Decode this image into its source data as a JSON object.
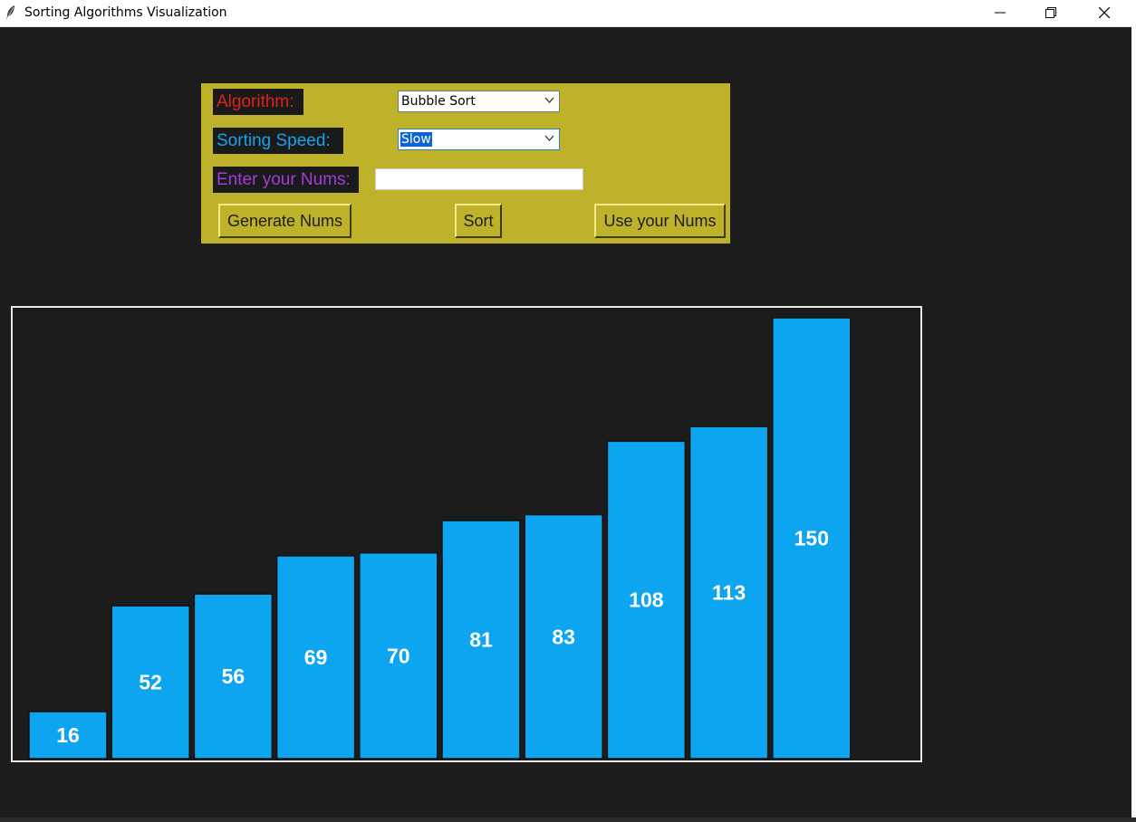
{
  "window": {
    "title": "Sorting Algorithms Visualization",
    "icon": "feather-icon",
    "controls": [
      "minimize-icon",
      "restore-icon",
      "close-icon"
    ]
  },
  "panel": {
    "bg_color": "#bdb22a",
    "algorithm_label": "Algorithm:",
    "algorithm_value": "Bubble Sort",
    "speed_label": "Sorting Speed:",
    "speed_value": "Slow",
    "nums_label": "Enter your Nums:",
    "nums_value": "",
    "generate_button": "Generate Nums",
    "sort_button": "Sort",
    "use_button": "Use your Nums"
  },
  "colors": {
    "algorithm_label": "#e0221a",
    "speed_label": "#1aa2e8",
    "nums_label": "#a43bd9",
    "bar_fill": "#0ea5f0",
    "background": "#1c1c1c"
  },
  "chart_data": {
    "type": "bar",
    "values": [
      16,
      52,
      56,
      69,
      70,
      81,
      83,
      108,
      113,
      150
    ],
    "ylim": [
      0,
      150
    ],
    "title": "",
    "xlabel": "",
    "ylabel": ""
  }
}
